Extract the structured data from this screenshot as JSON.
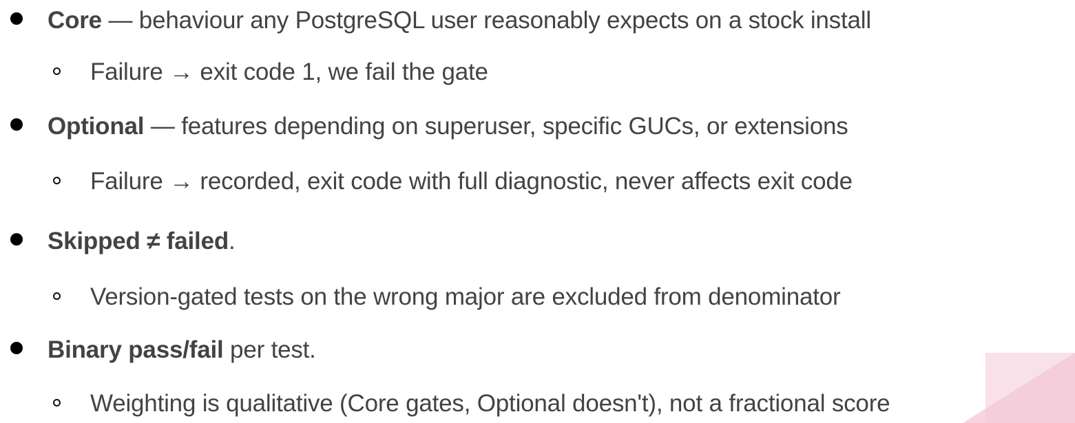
{
  "bullets": [
    {
      "bold": "Core",
      "rest": " — behaviour any PostgreSQL user reasonably expects on a stock install",
      "sub": "Failure → exit code 1,  we fail the gate"
    },
    {
      "bold": "Optional",
      "rest": " — features depending on superuser, specific GUCs, or extensions",
      "sub": "Failure → recorded, exit code with full diagnostic, never affects exit code"
    },
    {
      "bold": "Skipped ≠ failed",
      "rest": ".",
      "sub": "Version-gated tests on the wrong major are excluded from denominator"
    },
    {
      "bold": "Binary pass/fail",
      "rest": " per test.",
      "sub": "Weighting is qualitative (Core gates, Optional doesn't), not a fractional score"
    }
  ],
  "colors": {
    "text": "#434343",
    "bullet": "#000000",
    "corner_accent_light": "#f6d3de",
    "corner_accent_dark": "#efc1cf"
  }
}
